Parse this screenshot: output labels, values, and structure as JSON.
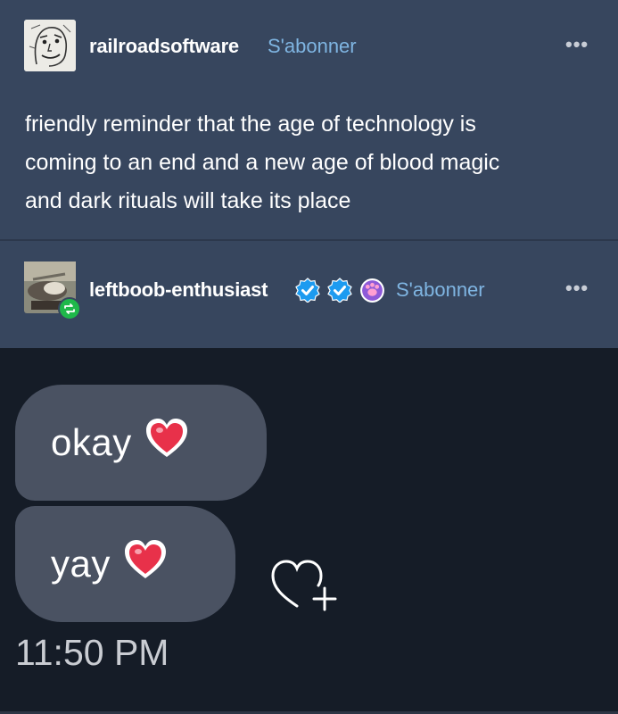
{
  "post1": {
    "username": "railroadsoftware",
    "follow_label": "S'abonner",
    "more_label": "•••",
    "text_lines": [
      "friendly reminder that the age of technology is",
      "coming to an end and a new age of blood magic",
      "and dark rituals will take its place"
    ]
  },
  "post2": {
    "username": "leftboob-enthusiast",
    "follow_label": "S'abonner",
    "more_label": "•••",
    "badges": [
      "blue-check-icon",
      "blue-check-icon",
      "purple-paw-icon"
    ]
  },
  "screenshot": {
    "messages": [
      {
        "text": "okay",
        "emoji": "red-heart-icon"
      },
      {
        "text": "yay",
        "emoji": "red-heart-icon"
      }
    ],
    "time": "11:50 PM",
    "react_icon": "heart-plus-icon"
  },
  "colors": {
    "background": "#37465e",
    "accent_link": "#7fb5e2",
    "bubble": "#4a5262",
    "chat_background": "#151c27",
    "reblog_green": "#1fb84a"
  }
}
